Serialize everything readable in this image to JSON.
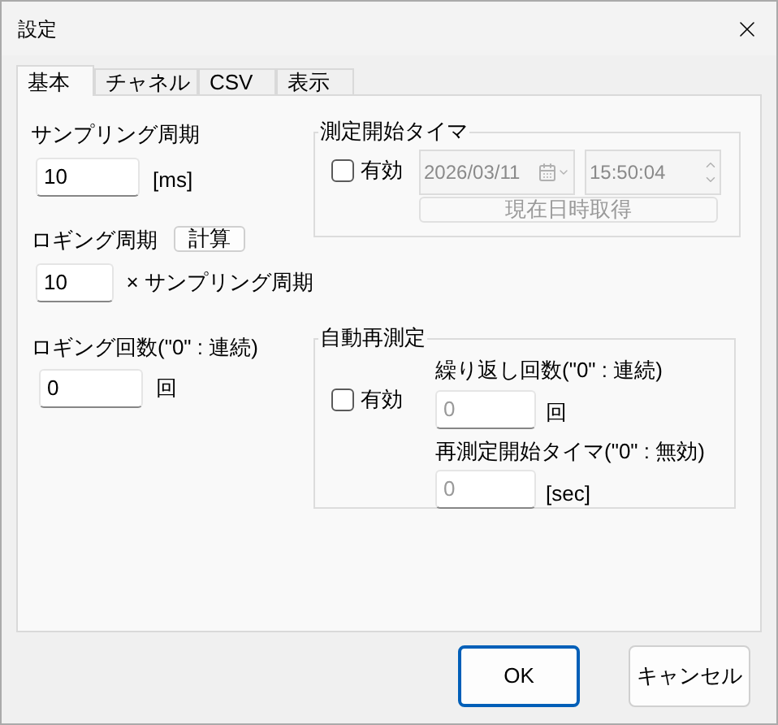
{
  "window": {
    "title": "設定"
  },
  "tabs": [
    {
      "label": "基本",
      "selected": true
    },
    {
      "label": "チャネル",
      "selected": false
    },
    {
      "label": "CSV",
      "selected": false
    },
    {
      "label": "表示",
      "selected": false
    }
  ],
  "sampling": {
    "label": "サンプリング周期",
    "value": "10",
    "unit": "[ms]"
  },
  "logging_period": {
    "label": "ロギング周期",
    "button": "計算",
    "value": "10",
    "unit": "× サンプリング周期"
  },
  "logging_count": {
    "label": "ロギング回数(\"0\" : 連続)",
    "value": "0",
    "unit": "回"
  },
  "start_timer": {
    "title": "測定開始タイマ",
    "enabled": {
      "label": "有効",
      "checked": false
    },
    "disabled": true,
    "date": "2026/03/11",
    "time": "15:50:04",
    "button": "現在日時取得"
  },
  "auto_remeasure": {
    "title": "自動再測定",
    "enabled": {
      "label": "有効",
      "checked": false
    },
    "disabled": true,
    "repeat_count": {
      "label": "繰り返し回数(\"0\" : 連続)",
      "value": "0",
      "unit": "回"
    },
    "restart_timer": {
      "label": "再測定開始タイマ(\"0\" : 無効)",
      "value": "0",
      "unit": "[sec]"
    }
  },
  "buttons": [
    {
      "label": "OK",
      "kind": "default"
    },
    {
      "label": "キャンセル",
      "kind": "normal"
    }
  ]
}
